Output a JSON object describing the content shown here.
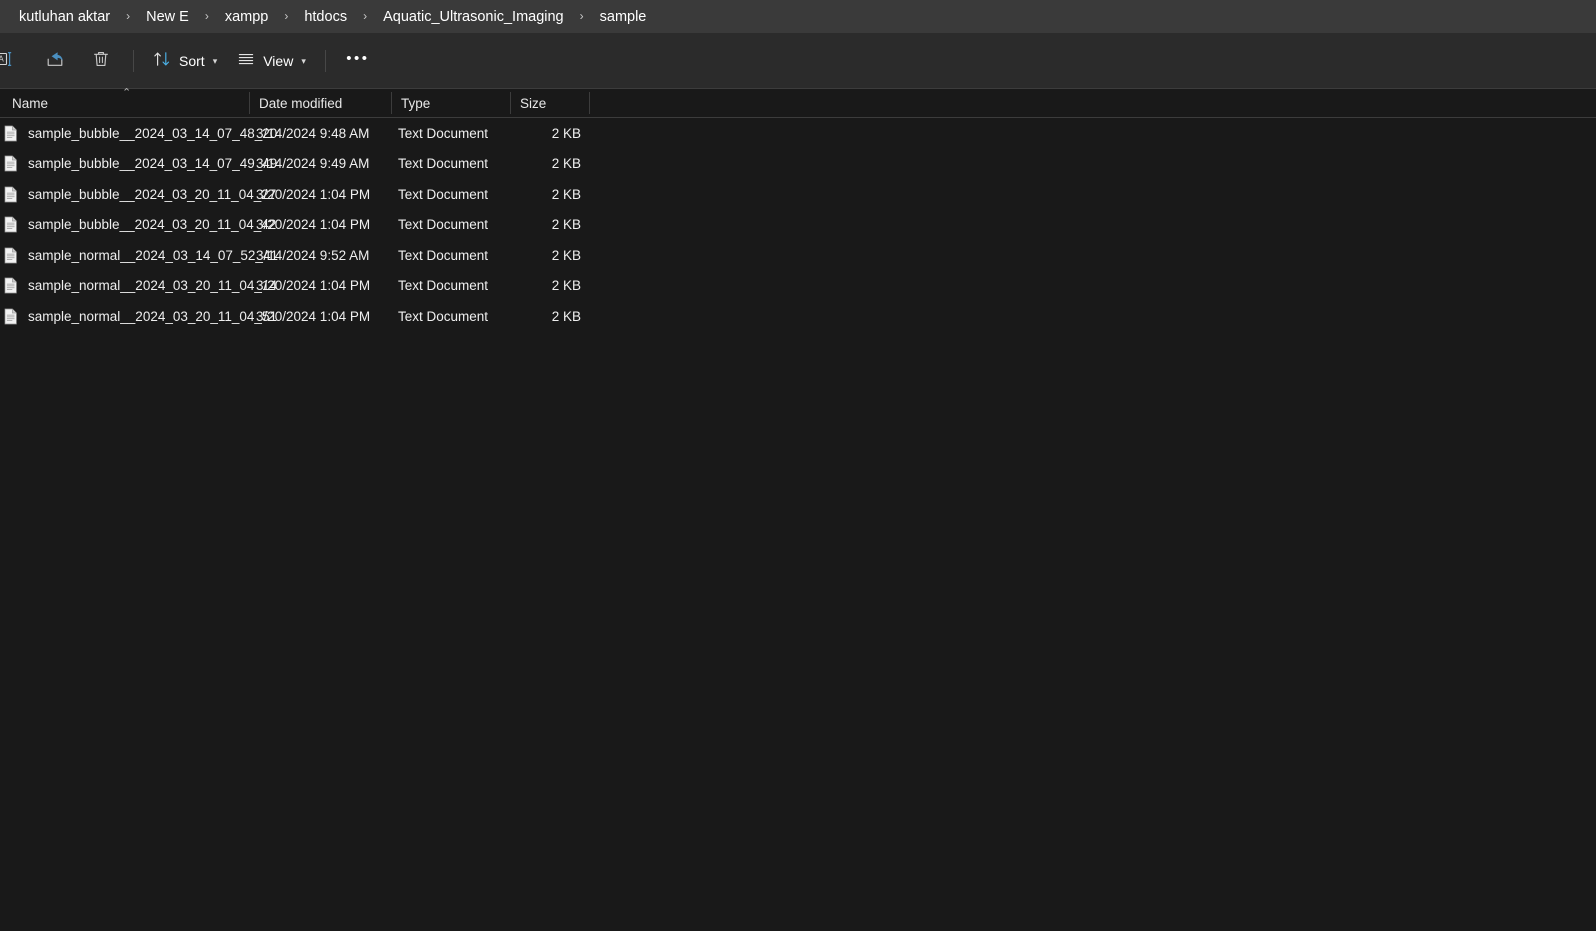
{
  "breadcrumb": {
    "separator": "›",
    "items": [
      {
        "label": "kutluhan aktar"
      },
      {
        "label": "New E"
      },
      {
        "label": "xampp"
      },
      {
        "label": "htdocs"
      },
      {
        "label": "Aquatic_Ultrasonic_Imaging"
      },
      {
        "label": "sample"
      }
    ]
  },
  "toolbar": {
    "rename_icon": "rename-icon",
    "share_icon": "share-icon",
    "delete_icon": "delete-icon",
    "sort_label": "Sort",
    "sort_icon": "sort-arrows-icon",
    "view_label": "View",
    "view_icon": "view-list-icon",
    "overflow_label": "•••",
    "chevron": "⌄"
  },
  "columns": {
    "name": "Name",
    "date_modified": "Date modified",
    "type": "Type",
    "size": "Size",
    "sort_indicator": "⌃",
    "sort_column": "Name",
    "sort_direction": "ascending"
  },
  "files": [
    {
      "name": "sample_bubble__2024_03_14_07_48_20",
      "date": "3/14/2024 9:48 AM",
      "type": "Text Document",
      "size": "2 KB",
      "icon": "text-document-icon"
    },
    {
      "name": "sample_bubble__2024_03_14_07_49_49",
      "date": "3/14/2024 9:49 AM",
      "type": "Text Document",
      "size": "2 KB",
      "icon": "text-document-icon"
    },
    {
      "name": "sample_bubble__2024_03_20_11_04_27",
      "date": "3/20/2024 1:04 PM",
      "type": "Text Document",
      "size": "2 KB",
      "icon": "text-document-icon"
    },
    {
      "name": "sample_bubble__2024_03_20_11_04_42",
      "date": "3/20/2024 1:04 PM",
      "type": "Text Document",
      "size": "2 KB",
      "icon": "text-document-icon"
    },
    {
      "name": "sample_normal__2024_03_14_07_52_41",
      "date": "3/14/2024 9:52 AM",
      "type": "Text Document",
      "size": "2 KB",
      "icon": "text-document-icon"
    },
    {
      "name": "sample_normal__2024_03_20_11_04_14",
      "date": "3/20/2024 1:04 PM",
      "type": "Text Document",
      "size": "2 KB",
      "icon": "text-document-icon"
    },
    {
      "name": "sample_normal__2024_03_20_11_04_51",
      "date": "3/20/2024 1:04 PM",
      "type": "Text Document",
      "size": "2 KB",
      "icon": "text-document-icon"
    }
  ],
  "colors": {
    "breadcrumb_bg": "#3a3a3a",
    "toolbar_bg": "#2b2b2b",
    "content_bg": "#191919",
    "text": "#ffffff",
    "accent": "#4cb2e8",
    "divider": "#3c3c3c"
  }
}
